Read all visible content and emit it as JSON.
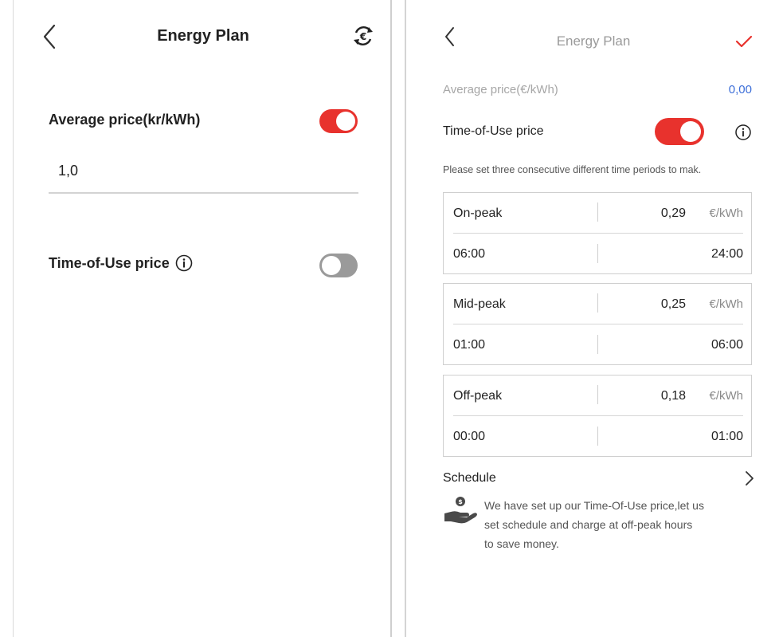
{
  "left": {
    "header": {
      "title": "Energy Plan",
      "back_icon": "chevron-left-icon",
      "currency_icon": "euro-cycle-icon"
    },
    "average_price": {
      "label": "Average price(kr/kWh)",
      "toggle_on": true,
      "value": "1,0"
    },
    "time_of_use": {
      "label": "Time-of-Use price",
      "toggle_on": false,
      "info_icon": "info-icon"
    }
  },
  "right": {
    "header": {
      "title": "Energy Plan",
      "back_icon": "chevron-left-icon",
      "confirm_icon": "checkmark-icon"
    },
    "average_price": {
      "label": "Average price(€/kWh)",
      "value": "0,00"
    },
    "time_of_use": {
      "label": "Time-of-Use price",
      "toggle_on": true,
      "info_icon": "info-icon",
      "hint": "Please set three consecutive different time periods to mak."
    },
    "periods": [
      {
        "name": "On-peak",
        "price": "0,29",
        "unit": "€/kWh",
        "start": "06:00",
        "end": "24:00"
      },
      {
        "name": "Mid-peak",
        "price": "0,25",
        "unit": "€/kWh",
        "start": "01:00",
        "end": "06:00"
      },
      {
        "name": "Off-peak",
        "price": "0,18",
        "unit": "€/kWh",
        "start": "00:00",
        "end": "01:00"
      }
    ],
    "schedule": {
      "label": "Schedule",
      "chevron_icon": "chevron-right-icon",
      "promo_icon": "hand-coin-icon",
      "promo_lines": [
        "We have set up our Time-Of-Use price,let us",
        "set schedule and charge at off-peak hours",
        "to save money."
      ]
    }
  },
  "colors": {
    "accent_red": "#e8322d",
    "toggle_off": "#9a9a9a",
    "link_blue": "#3d6fd9"
  }
}
